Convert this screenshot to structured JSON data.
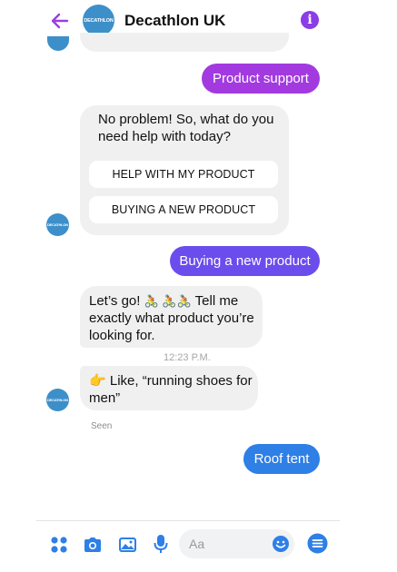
{
  "header": {
    "title": "Decathlon UK",
    "logo_text": "DECATHLON",
    "back_icon": "arrow-left-icon",
    "info_icon": "info-icon",
    "info_glyph": "i"
  },
  "messages": {
    "outgoing_1": "Product support",
    "incoming_1": {
      "text": "No problem! So, what do you need help with today?",
      "quick_replies": [
        "HELP WITH MY PRODUCT",
        "BUYING A NEW PRODUCT"
      ]
    },
    "outgoing_2": "Buying a new product",
    "incoming_2": {
      "text_before": "Let’s go! ",
      "emoji": "🚴 🚴🚴",
      "text_after": " Tell me exactly what product you’re looking for."
    },
    "timestamp": "12:23 P.M.",
    "incoming_3": {
      "emoji": "👉",
      "text": " Like, “running shoes for men”"
    },
    "seen": "Seen",
    "outgoing_3": "Roof tent"
  },
  "composer": {
    "placeholder": "Aa",
    "icons": [
      "apps-icon",
      "camera-icon",
      "gallery-icon",
      "microphone-icon",
      "emoji-icon",
      "menu-icon"
    ]
  },
  "colors": {
    "accent_purple": "#a23ae0",
    "accent_violet": "#6b4ded",
    "accent_blue": "#2e7fe6",
    "brand_blue": "#3d8fc9",
    "bubble_gray": "#f0f0f0"
  }
}
